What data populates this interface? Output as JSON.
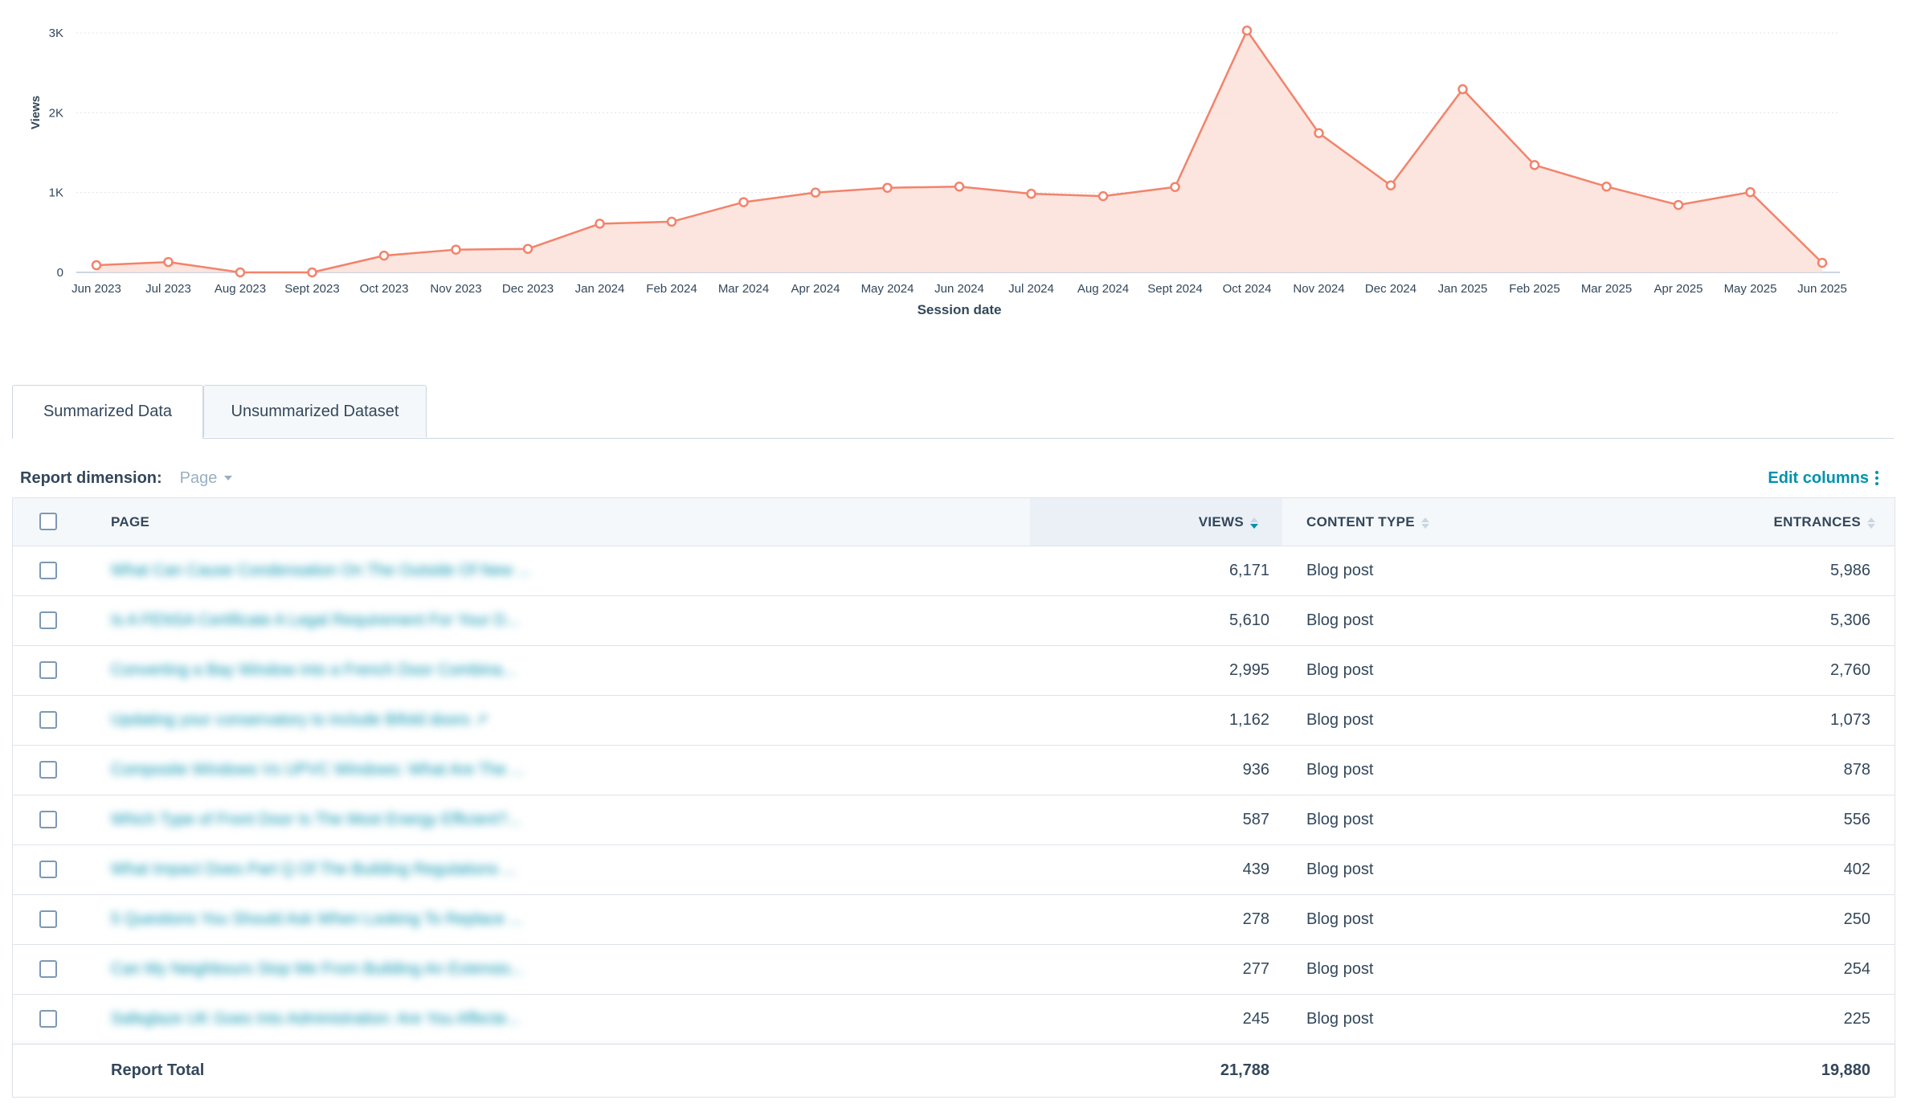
{
  "chart_data": {
    "type": "area",
    "title": "",
    "xlabel": "Session date",
    "ylabel": "Views",
    "ylim": [
      0,
      3000
    ],
    "yticks": [
      {
        "value": 0,
        "label": "0"
      },
      {
        "value": 1000,
        "label": "1K"
      },
      {
        "value": 2000,
        "label": "2K"
      },
      {
        "value": 3000,
        "label": "3K"
      }
    ],
    "categories": [
      "Jun 2023",
      "Jul 2023",
      "Aug 2023",
      "Sept 2023",
      "Oct 2023",
      "Nov 2023",
      "Dec 2023",
      "Jan 2024",
      "Feb 2024",
      "Mar 2024",
      "Apr 2024",
      "May 2024",
      "Jun 2024",
      "Jul 2024",
      "Aug 2024",
      "Sept 2024",
      "Oct 2024",
      "Nov 2024",
      "Dec 2024",
      "Jan 2025",
      "Feb 2025",
      "Mar 2025",
      "Apr 2025",
      "May 2025",
      "Jun 2025"
    ],
    "series": [
      {
        "values": [
          90,
          130,
          0,
          0,
          210,
          285,
          295,
          610,
          635,
          880,
          1000,
          1060,
          1075,
          985,
          955,
          1070,
          3030,
          1745,
          1090,
          2295,
          1345,
          1075,
          845,
          1005,
          120
        ]
      }
    ],
    "grid": true,
    "colors": {
      "line": "#f2836b",
      "fill": "#fde0d9",
      "grid": "#dfe3eb",
      "axis": "#cbd6e2"
    }
  },
  "tabs": [
    {
      "label": "Summarized Data",
      "active": true
    },
    {
      "label": "Unsummarized Dataset",
      "active": false
    }
  ],
  "dimension": {
    "label": "Report dimension:",
    "value": "Page"
  },
  "edit_columns": "Edit columns",
  "table": {
    "headers": {
      "page": "PAGE",
      "views": "VIEWS",
      "content_type": "CONTENT TYPE",
      "entrances": "ENTRANCES"
    },
    "rows": [
      {
        "page": "What Can Cause Condensation On The Outside Of New ...",
        "views": "6,171",
        "content_type": "Blog post",
        "entrances": "5,986"
      },
      {
        "page": "Is A FENSA Certificate A Legal Requirement For Your D...",
        "views": "5,610",
        "content_type": "Blog post",
        "entrances": "5,306"
      },
      {
        "page": "Converting a Bay Window into a French Door Combina...",
        "views": "2,995",
        "content_type": "Blog post",
        "entrances": "2,760"
      },
      {
        "page": "Updating your conservatory to include Bifold doors ↗",
        "views": "1,162",
        "content_type": "Blog post",
        "entrances": "1,073"
      },
      {
        "page": "Composite Windows Vs UPVC Windows: What Are The ...",
        "views": "936",
        "content_type": "Blog post",
        "entrances": "878"
      },
      {
        "page": "Which Type of Front Door Is The Most Energy Efficient?...",
        "views": "587",
        "content_type": "Blog post",
        "entrances": "556"
      },
      {
        "page": "What Impact Does Part Q Of The Building Regulations ...",
        "views": "439",
        "content_type": "Blog post",
        "entrances": "402"
      },
      {
        "page": "5 Questions You Should Ask When Looking To Replace ...",
        "views": "278",
        "content_type": "Blog post",
        "entrances": "250"
      },
      {
        "page": "Can My Neighbours Stop Me From Building An Extensio...",
        "views": "277",
        "content_type": "Blog post",
        "entrances": "254"
      },
      {
        "page": "Safeglaze UK Goes Into Administration: Are You Affecte...",
        "views": "245",
        "content_type": "Blog post",
        "entrances": "225"
      }
    ],
    "total": {
      "label": "Report Total",
      "views": "21,788",
      "entrances": "19,880"
    }
  }
}
